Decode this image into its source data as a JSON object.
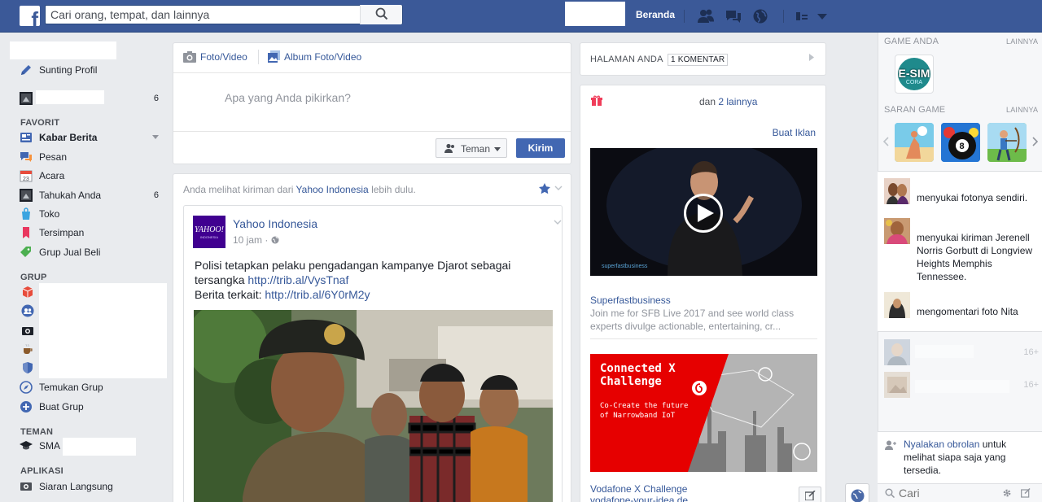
{
  "topbar": {
    "search_placeholder": "Cari orang, tempat, dan lainnya",
    "home_label": "Beranda"
  },
  "left_nav": {
    "edit_profile": "Sunting Profil",
    "page_count": "6",
    "favorites_heading": "FAVORIT",
    "favorites": [
      {
        "label": "Kabar Berita",
        "count": ""
      },
      {
        "label": "Pesan",
        "count": ""
      },
      {
        "label": "Acara",
        "count": ""
      },
      {
        "label": "Tahukah Anda",
        "count": "6"
      },
      {
        "label": "Toko",
        "count": ""
      },
      {
        "label": "Tersimpan",
        "count": ""
      },
      {
        "label": "Grup Jual Beli",
        "count": ""
      }
    ],
    "groups_heading": "GRUP",
    "find_groups": "Temukan Grup",
    "create_group": "Buat Grup",
    "friends_heading": "TEMAN",
    "friends_item": "SMA",
    "apps_heading": "APLIKASI",
    "apps_item": "Siaran Langsung"
  },
  "composer": {
    "tab_photo": "Foto/Video",
    "tab_album": "Album Foto/Video",
    "placeholder": "Apa yang Anda pikirkan?",
    "audience": "Teman",
    "post_button": "Kirim"
  },
  "post": {
    "see_first_prefix": "Anda melihat kiriman dari",
    "see_first_source": "Yahoo Indonesia",
    "see_first_suffix": "lebih dulu.",
    "logo_text": "YAHOO!",
    "logo_sub": "INDONESIA",
    "author": "Yahoo Indonesia",
    "time": "10 jam",
    "separator": "·",
    "text_line1": "Polisi tetapkan pelaku pengadangan kampanye Djarot sebagai",
    "text_line2_prefix": "tersangka",
    "link1": "http://trib.al/VysTnaf",
    "text_line3_prefix": "Berita terkait:",
    "link2": "http://trib.al/6Y0rM2y"
  },
  "pages_box": {
    "heading": "HALAMAN ANDA",
    "badge": "1 KOMENTAR"
  },
  "ads": {
    "others_prefix": "dan",
    "others_link": "2 lainnya",
    "create_ad": "Buat Iklan",
    "ad1_title": "Superfastbusiness",
    "ad1_desc_line1": "Join me for SFB Live 2017 and see world class",
    "ad1_desc_line2": "experts divulge actionable, entertaining, cr...",
    "ad1_video_caption": "superfastbusiness",
    "ad2_banner_title_line1": "Connected X",
    "ad2_banner_title_line2": "Challenge",
    "ad2_banner_sub_line1": "Co-Create the future",
    "ad2_banner_sub_line2": "of Narrowband IoT",
    "ad2_title": "Vodafone X Challenge",
    "ad2_url": "vodafone-your-idea.de"
  },
  "right_rail": {
    "games_heading": "GAME ANDA",
    "games_more": "LAINNYA",
    "game_logo": "E-SIM",
    "game_logo_sub": "CORA",
    "suggested_heading": "SARAN GAME",
    "suggested_more": "LAINNYA",
    "ticker": [
      {
        "text": "menyukai fotonya sendiri."
      },
      {
        "text": "menyukai kiriman Jerenell Norris Gorbutt di Longview Heights Memphis Tennessee."
      },
      {
        "text": "mengomentari foto Nita"
      }
    ],
    "chat_counts": [
      "16+",
      "16+"
    ],
    "chat_prompt_link": "Nyalakan obrolan",
    "chat_prompt_rest": "untuk melihat siapa saja yang tersedia.",
    "chat_search_placeholder": "Cari"
  },
  "colors": {
    "brand_blue": "#3b5998",
    "button_blue": "#4267b2",
    "link_blue": "#365899",
    "page_bg": "#e9ebee",
    "vodafone_red": "#e60000"
  }
}
